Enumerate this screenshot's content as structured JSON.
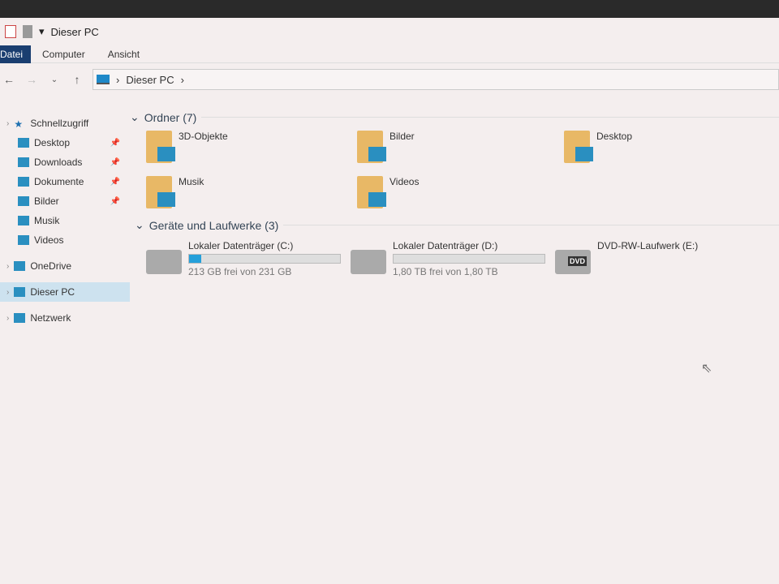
{
  "window": {
    "title": "Dieser PC"
  },
  "ribbon": {
    "tabs": [
      "Datei",
      "Computer",
      "Ansicht"
    ]
  },
  "address": {
    "path": "Dieser PC"
  },
  "sidebar": {
    "items": [
      {
        "label": "Schnellzugriff",
        "icon": "star-icon",
        "pinned": false,
        "top": true
      },
      {
        "label": "Desktop",
        "icon": "desktop-icon",
        "pinned": true
      },
      {
        "label": "Downloads",
        "icon": "download-icon",
        "pinned": true
      },
      {
        "label": "Dokumente",
        "icon": "document-icon",
        "pinned": true
      },
      {
        "label": "Bilder",
        "icon": "pictures-icon",
        "pinned": true
      },
      {
        "label": "Musik",
        "icon": "music-icon",
        "pinned": false
      },
      {
        "label": "Videos",
        "icon": "video-icon",
        "pinned": false
      },
      {
        "label": "OneDrive",
        "icon": "cloud-icon",
        "top": true
      },
      {
        "label": "Dieser PC",
        "icon": "pc-icon",
        "top": true,
        "selected": true
      },
      {
        "label": "Netzwerk",
        "icon": "network-icon",
        "top": true
      }
    ]
  },
  "folders_group": {
    "title": "Ordner (7)",
    "items": [
      "3D-Objekte",
      "Bilder",
      "Desktop",
      "Musik",
      "Videos"
    ]
  },
  "drives_group": {
    "title": "Geräte und Laufwerke (3)",
    "items": [
      {
        "name": "Lokaler Datenträger (C:)",
        "space": "213 GB frei von 231 GB",
        "used_fraction": 0.078
      },
      {
        "name": "Lokaler Datenträger (D:)",
        "space": "1,80 TB frei von 1,80 TB",
        "used_fraction": 0.0
      },
      {
        "name": "DVD-RW-Laufwerk (E:)",
        "badge": "DVD"
      }
    ]
  },
  "colors": {
    "accent": "#26a0da",
    "tab_active": "#1a3e70",
    "selection": "#cde2ef"
  }
}
